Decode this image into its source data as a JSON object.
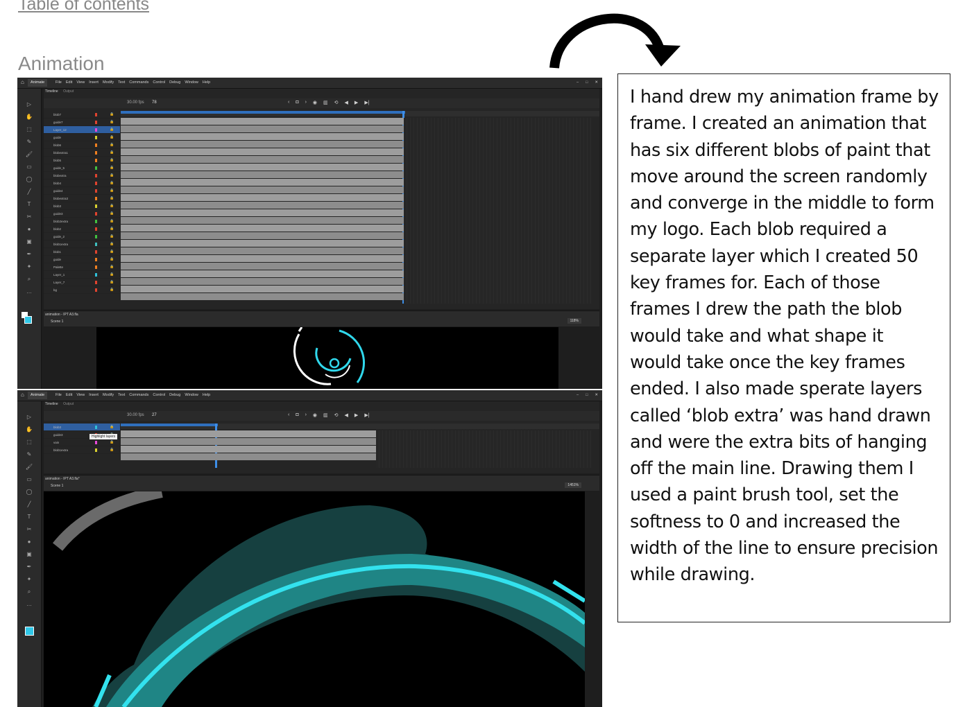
{
  "doc": {
    "toc_link": "Table of contents",
    "section_title": "Animation",
    "explanation": "I hand drew my animation frame by frame. I created an animation that has six different blobs of paint that move around the screen randomly and converge in the middle to form my logo. Each blob required a separate layer which I created 50 key frames for. Each of those frames I drew the path the blob would take and what shape it would take once the key frames ended. I also made sperate layers called ‘blob extra’ was hand drawn and were the extra bits of hanging off the main line. Drawing them I used a paint brush tool, set the softness to 0 and increased the width of the line to ensure precision while drawing."
  },
  "app": {
    "name": "Animate",
    "menus": [
      "File",
      "Edit",
      "View",
      "Insert",
      "Modify",
      "Text",
      "Commands",
      "Control",
      "Debug",
      "Window",
      "Help"
    ],
    "timeline_tab": "Timeline",
    "output_tab": "Output",
    "fps": "30.00 fps",
    "scene_label": "Scene 1"
  },
  "screen1": {
    "frame_number": "78",
    "document_tab": "animation - IPT A3.fla",
    "zoom": "118%",
    "layers": [
      {
        "name": "blob7",
        "color": "#e0432f"
      },
      {
        "name": "guide7",
        "color": "#e0432f"
      },
      {
        "name": "Layer_12",
        "color": "#e848d8",
        "selected": true
      },
      {
        "name": "guide",
        "color": "#d8d030"
      },
      {
        "name": "blob6",
        "color": "#f08020"
      },
      {
        "name": "blobextra1",
        "color": "#f08020"
      },
      {
        "name": "blob5",
        "color": "#f08020"
      },
      {
        "name": "guide_5",
        "color": "#40c040"
      },
      {
        "name": "blobextra",
        "color": "#e0432f"
      },
      {
        "name": "blob4",
        "color": "#e0432f"
      },
      {
        "name": "guide4",
        "color": "#e0432f"
      },
      {
        "name": "blobextra3",
        "color": "#f08020"
      },
      {
        "name": "blob3",
        "color": "#d8d030"
      },
      {
        "name": "guide3",
        "color": "#e0432f"
      },
      {
        "name": "blob2extra",
        "color": "#40c040"
      },
      {
        "name": "blob2",
        "color": "#e0432f"
      },
      {
        "name": "guide_2",
        "color": "#40c040"
      },
      {
        "name": "blob1extra",
        "color": "#40c0c0"
      },
      {
        "name": "blob1",
        "color": "#e0432f"
      },
      {
        "name": "guide",
        "color": "#f08020"
      },
      {
        "name": "Palette",
        "color": "#f08020"
      },
      {
        "name": "Layer_1",
        "color": "#30c0d8"
      },
      {
        "name": "Layer_7",
        "color": "#e0432f"
      },
      {
        "name": "bg",
        "color": "#e0432f"
      }
    ]
  },
  "screen2": {
    "frame_number": "27",
    "document_tab": "animation - IPT A3.fla*",
    "zoom": "1451%",
    "tooltip": "Highlight layers",
    "layers": [
      {
        "name": "blob3",
        "color": "#30c0d8",
        "selected": true
      },
      {
        "name": "guide3",
        "color": "#e0432f"
      },
      {
        "name": "vain",
        "color": "#e848d8"
      },
      {
        "name": "blob1extra",
        "color": "#d8d030"
      }
    ]
  },
  "icons": {
    "arrow": "curved-arrow-icon",
    "home": "home-icon",
    "play": "play-icon",
    "lock": "lock-icon"
  }
}
